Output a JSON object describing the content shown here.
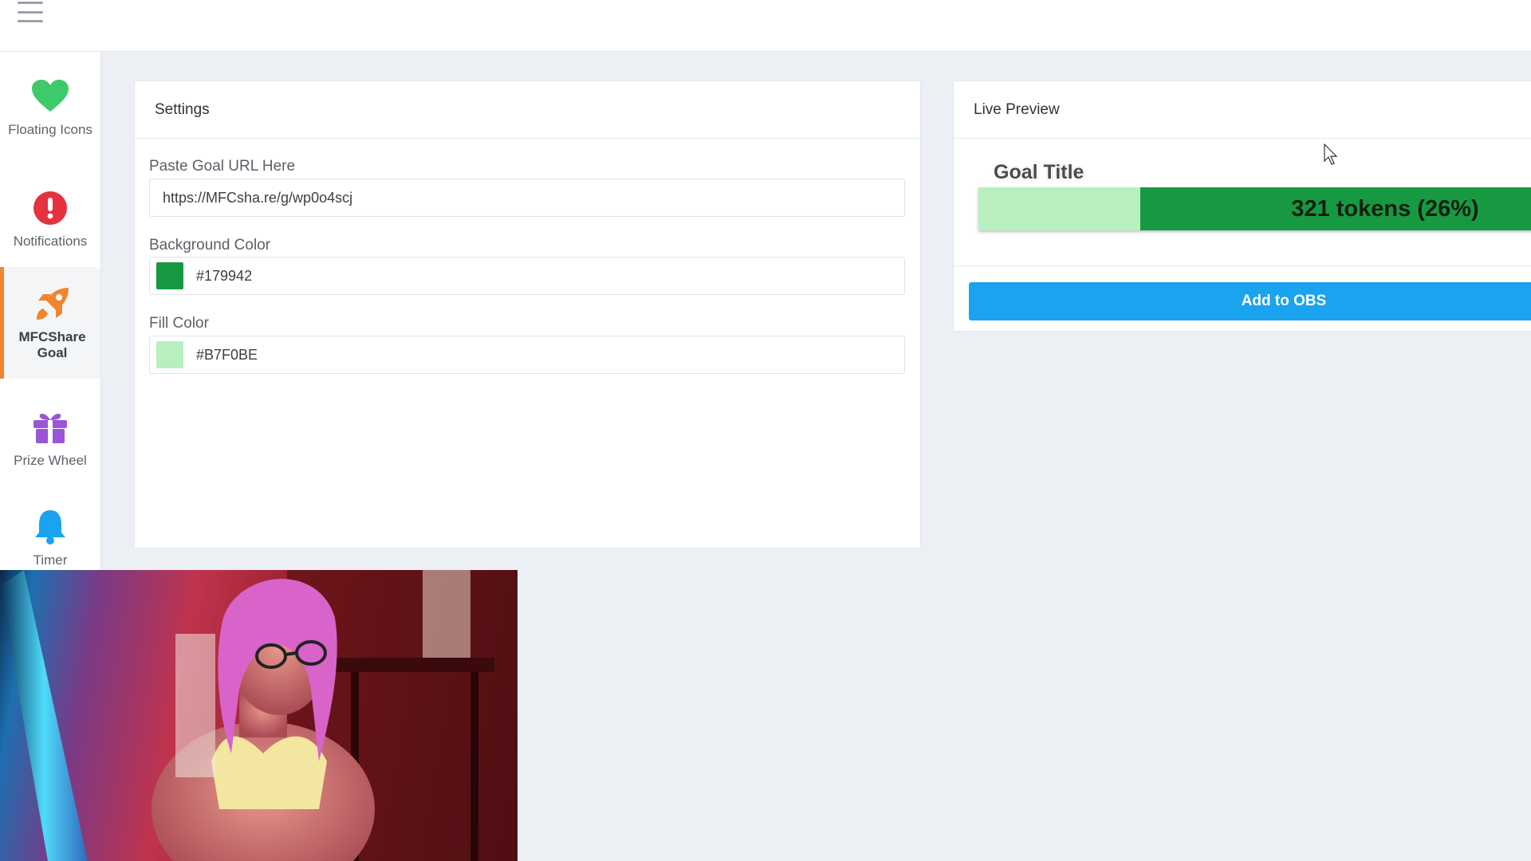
{
  "sidebar": {
    "items": [
      {
        "label": "Floating Icons",
        "icon": "heart-icon",
        "color": "#3ec96a"
      },
      {
        "label": "Notifications",
        "icon": "alert-icon",
        "color": "#e5323f"
      },
      {
        "label": "MFCShare Goal",
        "icon": "rocket-icon",
        "color": "#f0852d",
        "active": true
      },
      {
        "label": "Prize Wheel",
        "icon": "gift-icon",
        "color": "#9b55d8"
      },
      {
        "label": "Timer",
        "icon": "bell-icon",
        "color": "#1aa3ef"
      }
    ]
  },
  "settings": {
    "title": "Settings",
    "goal_url_label": "Paste Goal URL Here",
    "goal_url_value": "https://MFCsha.re/g/wp0o4scj",
    "background_color_label": "Background Color",
    "background_color_value": "#179942",
    "fill_color_label": "Fill Color",
    "fill_color_value": "#B7F0BE"
  },
  "preview": {
    "title": "Live Preview",
    "goal_title": "Goal Title",
    "goal_text": "321 tokens (26%)",
    "goal_progress": 0.26,
    "add_button_label": "Add to OBS"
  },
  "colors": {
    "accent": "#f0852d",
    "button": "#1aa3ef",
    "goal_background": "#179942",
    "goal_fill": "#B7F0BE"
  }
}
